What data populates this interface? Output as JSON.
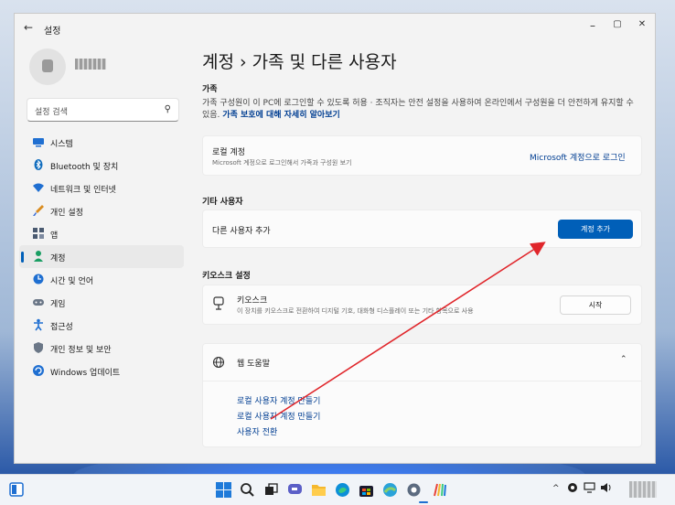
{
  "window": {
    "app_title": "설정",
    "controls": {
      "minimize": "–",
      "maximize": "▢",
      "close": "✕"
    },
    "back_glyph": "←"
  },
  "search": {
    "placeholder": "설정 검색"
  },
  "nav": {
    "items": [
      {
        "label": "시스템",
        "icon": "monitor-icon",
        "color": "#1f6fd1"
      },
      {
        "label": "Bluetooth 및 장치",
        "icon": "bluetooth-icon",
        "color": "#0f6cbd"
      },
      {
        "label": "네트워크 및 인터넷",
        "icon": "wifi-icon",
        "color": "#1f6fd1"
      },
      {
        "label": "개인 설정",
        "icon": "brush-icon",
        "color": "#d98c1f"
      },
      {
        "label": "앱",
        "icon": "apps-icon",
        "color": "#4a5a70"
      },
      {
        "label": "계정",
        "icon": "person-icon",
        "color": "#1a9e63"
      },
      {
        "label": "시간 및 언어",
        "icon": "globe-clock-icon",
        "color": "#1f6fd1"
      },
      {
        "label": "게임",
        "icon": "gamepad-icon",
        "color": "#6b7787"
      },
      {
        "label": "접근성",
        "icon": "accessibility-icon",
        "color": "#1f6fd1"
      },
      {
        "label": "개인 정보 및 보안",
        "icon": "shield-icon",
        "color": "#6b7787"
      },
      {
        "label": "Windows 업데이트",
        "icon": "update-icon",
        "color": "#1f6fd1"
      }
    ],
    "active_index": 5
  },
  "page": {
    "title": "계정 › 가족 및 다른 사용자"
  },
  "family": {
    "heading": "가족",
    "description": "가족 구성원이 이 PC에 로그인할 수 있도록 허용 · 조직자는 안전 설정을 사용하여 온라인에서 구성원을 더 안전하게 유지할 수 있음.",
    "link": "가족 보호에 대해 자세히 알아보기",
    "card_title": "로컬 계정",
    "card_sub": "Microsoft 계정으로 로그인해서 가족과 구성원 보기",
    "card_link": "Microsoft 계정으로 로그인"
  },
  "other_users": {
    "heading": "기타 사용자",
    "row_label": "다른 사용자 추가",
    "button": "계정 추가"
  },
  "kiosk": {
    "heading": "키오스크 설정",
    "title": "키오스크",
    "sub": "이 장치를 키오스크로 전환하여 디지털 기호, 대화형 디스플레이 또는 기타 항목으로 사용",
    "button": "시작"
  },
  "help": {
    "title": "웹 도움말",
    "links": [
      "로컬 사용자 계정 만들기",
      "로컬 사용자 계정 만들기",
      "사용자 전환"
    ]
  },
  "taskbar": {
    "apps": [
      "windows-start",
      "search",
      "task-view",
      "teams-chat",
      "file-explorer",
      "edge",
      "store",
      "maps",
      "settings",
      "paint"
    ],
    "tray_caret": "^"
  }
}
